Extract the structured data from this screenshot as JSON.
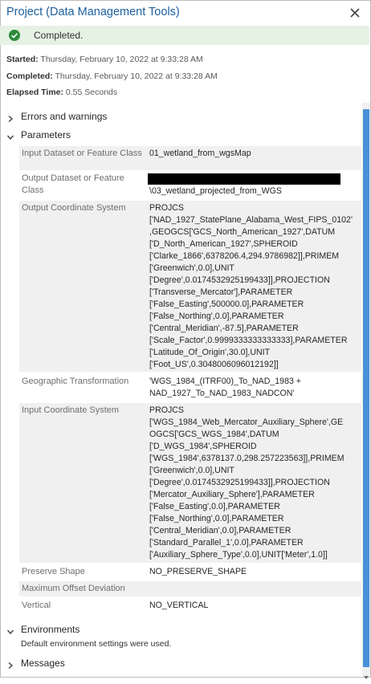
{
  "window": {
    "title": "Project (Data Management Tools)"
  },
  "status": {
    "text": "Completed.",
    "color": "#2e8b3a"
  },
  "info": {
    "started_label": "Started:",
    "started_value": " Thursday, February 10, 2022 at 9:33:28 AM",
    "completed_label": "Completed:",
    "completed_value": " Thursday, February 10, 2022 at 9:33:28 AM",
    "elapsed_label": "Elapsed Time:",
    "elapsed_value": " 0.55 Seconds"
  },
  "sections": {
    "errors": "Errors and warnings",
    "parameters": "Parameters",
    "environments": "Environments",
    "environments_text": "Default environment settings were used.",
    "messages": "Messages"
  },
  "params": [
    {
      "name": "Input Dataset or Feature Class",
      "value": "01_wetland_from_wgsMap"
    },
    {
      "name": "Output Dataset or Feature Class",
      "value": "\\03_wetland_projected_from_WGS"
    },
    {
      "name": "Output Coordinate System",
      "value": "PROJCS\n['NAD_1927_StatePlane_Alabama_West_FIPS_0102'\n,GEOGCS['GCS_North_American_1927',DATUM\n['D_North_American_1927',SPHEROID\n['Clarke_1866',6378206.4,294.9786982]],PRIMEM\n['Greenwich',0.0],UNIT\n['Degree',0.0174532925199433]],PROJECTION\n['Transverse_Mercator'],PARAMETER\n['False_Easting',500000.0],PARAMETER\n['False_Northing',0.0],PARAMETER\n['Central_Meridian',-87.5],PARAMETER\n['Scale_Factor',0.9999333333333333],PARAMETER\n['Latitude_Of_Origin',30.0],UNIT\n['Foot_US',0.3048006096012192]]"
    },
    {
      "name": "Geographic Transformation",
      "value": "'WGS_1984_(ITRF00)_To_NAD_1983 +\nNAD_1927_To_NAD_1983_NADCON'"
    },
    {
      "name": "Input Coordinate System",
      "value": "PROJCS\n['WGS_1984_Web_Mercator_Auxiliary_Sphere',GE\nOGCS['GCS_WGS_1984',DATUM\n['D_WGS_1984',SPHEROID\n['WGS_1984',6378137.0,298.257223563]],PRIMEM\n['Greenwich',0.0],UNIT\n['Degree',0.0174532925199433]],PROJECTION\n['Mercator_Auxiliary_Sphere'],PARAMETER\n['False_Easting',0.0],PARAMETER\n['False_Northing',0.0],PARAMETER\n['Central_Meridian',0.0],PARAMETER\n['Standard_Parallel_1',0.0],PARAMETER\n['Auxiliary_Sphere_Type',0.0],UNIT['Meter',1.0]]"
    },
    {
      "name": "Preserve Shape",
      "value": "NO_PRESERVE_SHAPE"
    },
    {
      "name": "Maximum Offset Deviation",
      "value": ""
    },
    {
      "name": "Vertical",
      "value": "NO_VERTICAL"
    }
  ]
}
